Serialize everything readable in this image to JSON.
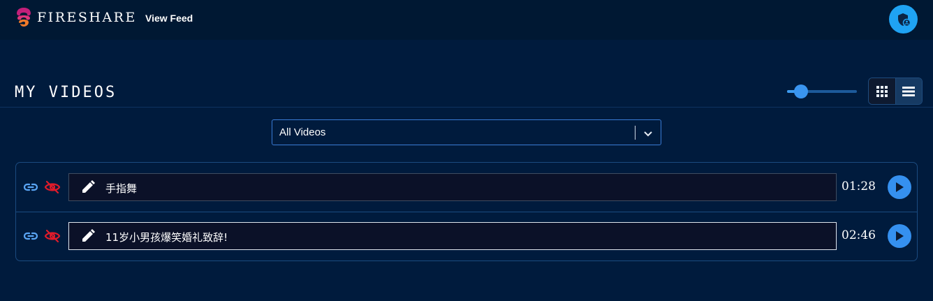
{
  "header": {
    "brand": "FIRESHARE",
    "nav_view_feed": "View Feed",
    "icons": {
      "logo": "fireshare-logo",
      "avatar": "shield-person-icon"
    }
  },
  "main": {
    "title": "MY VIDEOS",
    "card_size_slider": {
      "value_fraction": 0.2
    },
    "view_modes": [
      {
        "name": "grid",
        "icon": "grid-icon",
        "active": false
      },
      {
        "name": "list",
        "icon": "list-icon",
        "active": true
      }
    ],
    "filter": {
      "selected": "All Videos"
    },
    "videos": [
      {
        "title": "手指舞",
        "duration": "01:28",
        "editing": false
      },
      {
        "title": "11岁小男孩爆笑婚礼致辞!",
        "duration": "02:46",
        "editing": true
      }
    ]
  },
  "colors": {
    "background": "#001b3d",
    "accent": "#3590ef",
    "hidden_icon": "#e01b2a",
    "link_icon": "#5aa6f5"
  }
}
